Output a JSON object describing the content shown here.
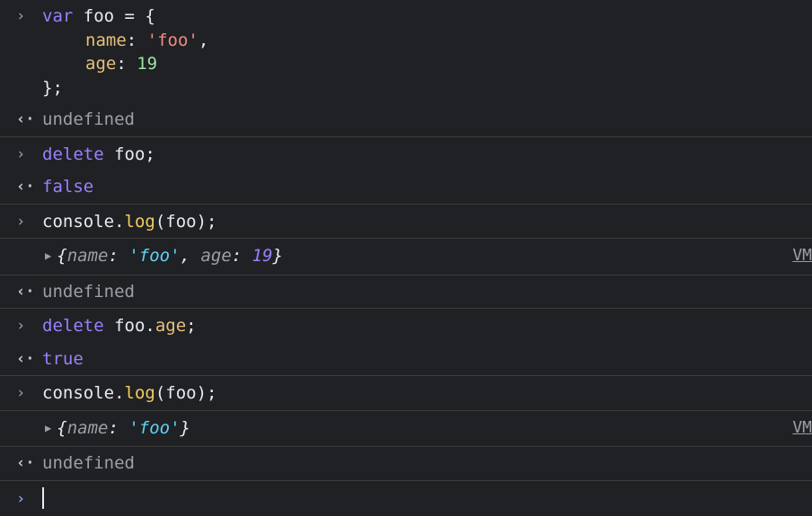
{
  "console": {
    "entries": [
      {
        "kind": "input",
        "lines": [
          {
            "t": [
              {
                "c": "kw",
                "v": "var"
              },
              {
                "c": "plain",
                "v": " foo = {"
              }
            ]
          },
          {
            "indent": true,
            "t": [
              {
                "c": "prop",
                "v": "name"
              },
              {
                "c": "plain",
                "v": ": "
              },
              {
                "c": "str",
                "v": "'foo'"
              },
              {
                "c": "plain",
                "v": ","
              }
            ]
          },
          {
            "indent": true,
            "t": [
              {
                "c": "prop",
                "v": "age"
              },
              {
                "c": "plain",
                "v": ": "
              },
              {
                "c": "num",
                "v": "19"
              }
            ]
          },
          {
            "t": [
              {
                "c": "plain",
                "v": "};"
              }
            ]
          }
        ]
      },
      {
        "kind": "result",
        "text": "undefined",
        "style": "undef"
      },
      {
        "kind": "input",
        "lines": [
          {
            "t": [
              {
                "c": "kw",
                "v": "delete"
              },
              {
                "c": "plain",
                "v": " foo;"
              }
            ]
          }
        ]
      },
      {
        "kind": "result",
        "text": "false",
        "style": "bool"
      },
      {
        "kind": "input",
        "lines": [
          {
            "t": [
              {
                "c": "plain",
                "v": "console."
              },
              {
                "c": "fn",
                "v": "log"
              },
              {
                "c": "plain",
                "v": "(foo);"
              }
            ]
          }
        ]
      },
      {
        "kind": "log",
        "source": "VM",
        "t": [
          {
            "c": "obj-punc",
            "v": "{"
          },
          {
            "c": "obj-key",
            "v": "name"
          },
          {
            "c": "obj-punc",
            "v": ": "
          },
          {
            "c": "obj-str",
            "v": "'foo'"
          },
          {
            "c": "obj-punc",
            "v": ", "
          },
          {
            "c": "obj-key",
            "v": "age"
          },
          {
            "c": "obj-punc",
            "v": ": "
          },
          {
            "c": "obj-num",
            "v": "19"
          },
          {
            "c": "obj-punc",
            "v": "}"
          }
        ]
      },
      {
        "kind": "result",
        "text": "undefined",
        "style": "undef"
      },
      {
        "kind": "input",
        "lines": [
          {
            "t": [
              {
                "c": "kw",
                "v": "delete"
              },
              {
                "c": "plain",
                "v": " foo."
              },
              {
                "c": "prop",
                "v": "age"
              },
              {
                "c": "plain",
                "v": ";"
              }
            ]
          }
        ]
      },
      {
        "kind": "result",
        "text": "true",
        "style": "bool"
      },
      {
        "kind": "input",
        "lines": [
          {
            "t": [
              {
                "c": "plain",
                "v": "console."
              },
              {
                "c": "fn",
                "v": "log"
              },
              {
                "c": "plain",
                "v": "(foo);"
              }
            ]
          }
        ]
      },
      {
        "kind": "log",
        "source": "VM",
        "t": [
          {
            "c": "obj-punc",
            "v": "{"
          },
          {
            "c": "obj-key",
            "v": "name"
          },
          {
            "c": "obj-punc",
            "v": ": "
          },
          {
            "c": "obj-str",
            "v": "'foo'"
          },
          {
            "c": "obj-punc",
            "v": "}"
          }
        ]
      },
      {
        "kind": "result",
        "text": "undefined",
        "style": "undef"
      },
      {
        "kind": "prompt"
      }
    ],
    "icons": {
      "input": "chevron-right-icon",
      "result": "return-arrow-icon",
      "expand": "expand-triangle-icon"
    },
    "glyphs": {
      "input": "›",
      "result": "‹·",
      "expand": "▶"
    }
  }
}
